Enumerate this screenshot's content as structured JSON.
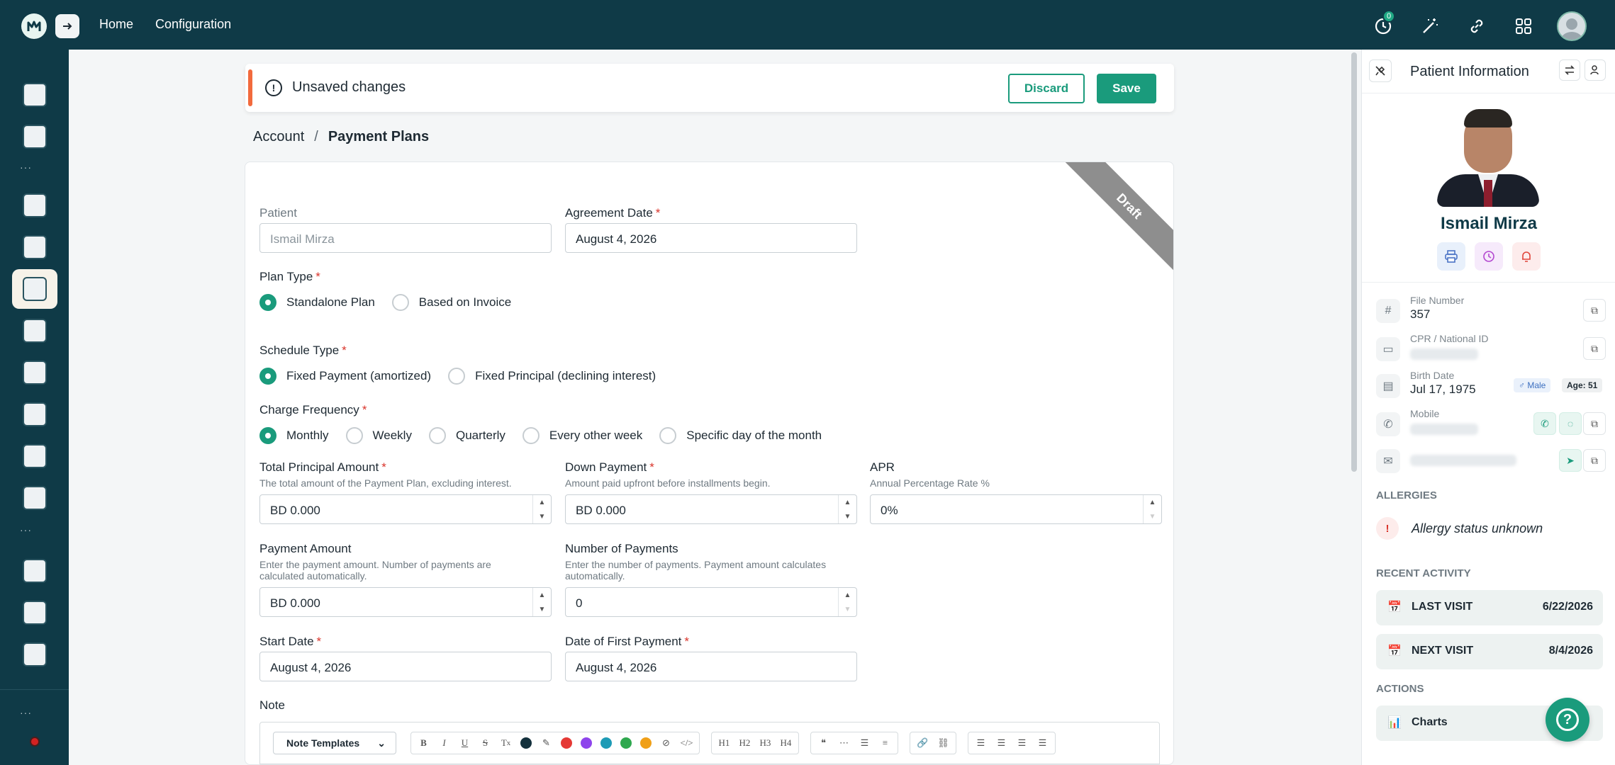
{
  "topbar": {
    "nav": [
      "Home",
      "Configuration"
    ],
    "notification_count": "0",
    "icons": [
      "clock-icon",
      "magic-wand-icon",
      "link-icon",
      "apps-grid-icon",
      "user-avatar"
    ]
  },
  "banner": {
    "message": "Unsaved changes",
    "discard_label": "Discard",
    "save_label": "Save"
  },
  "breadcrumb": {
    "parent": "Account",
    "separator": "/",
    "current": "Payment Plans"
  },
  "form": {
    "status_ribbon": "Draft",
    "patient": {
      "label": "Patient",
      "value": "Ismail Mirza"
    },
    "agreement_date": {
      "label": "Agreement Date",
      "value": "August 4, 2026"
    },
    "plan_type": {
      "label": "Plan Type",
      "options": [
        "Standalone Plan",
        "Based on Invoice"
      ],
      "selected": 0
    },
    "schedule_type": {
      "label": "Schedule Type",
      "options": [
        "Fixed Payment (amortized)",
        "Fixed Principal (declining interest)"
      ],
      "selected": 0
    },
    "charge_frequency": {
      "label": "Charge Frequency",
      "options": [
        "Monthly",
        "Weekly",
        "Quarterly",
        "Every other week",
        "Specific day of the month"
      ],
      "selected": 0
    },
    "total_principal": {
      "label": "Total Principal Amount",
      "hint": "The total amount of the Payment Plan, excluding interest.",
      "value": "BD 0.000"
    },
    "down_payment": {
      "label": "Down Payment",
      "hint": "Amount paid upfront before installments begin.",
      "value": "BD 0.000"
    },
    "apr": {
      "label": "APR",
      "hint": "Annual Percentage Rate %",
      "value": "0%"
    },
    "payment_amount": {
      "label": "Payment Amount",
      "hint": "Enter the payment amount. Number of payments are calculated automatically.",
      "value": "BD 0.000"
    },
    "number_of_payments": {
      "label": "Number of Payments",
      "hint": "Enter the number of payments. Payment amount calculates automatically.",
      "value": "0"
    },
    "start_date": {
      "label": "Start Date",
      "value": "August 4, 2026"
    },
    "first_payment_date": {
      "label": "Date of First Payment",
      "value": "August 4, 2026"
    },
    "note": {
      "label": "Note",
      "template_select": "Note Templates"
    }
  },
  "editor_colors": [
    "#14313d",
    "#e53935",
    "#8e44ec",
    "#1e9bb6",
    "#2fa84f",
    "#f0a018"
  ],
  "patient_panel": {
    "title": "Patient Information",
    "name": "Ismail Mirza",
    "file_number_label": "File Number",
    "file_number": "357",
    "national_id_label": "CPR / National ID",
    "birth_date_label": "Birth Date",
    "birth_date": "Jul 17, 1975",
    "gender": "♂ Male",
    "age": "Age: 51",
    "mobile_label": "Mobile",
    "allergies_heading": "ALLERGIES",
    "allergy_status": "Allergy status unknown",
    "recent_activity_heading": "RECENT ACTIVITY",
    "last_visit_label": "LAST VISIT",
    "last_visit_date": "6/22/2026",
    "next_visit_label": "NEXT VISIT",
    "next_visit_date": "8/4/2026",
    "actions_heading": "ACTIONS",
    "charts_label": "Charts"
  },
  "colors": {
    "primary": "#1a9b7c",
    "navbar": "#0f3a47",
    "warning_accent": "#f26a3d",
    "required": "#d9342b"
  }
}
